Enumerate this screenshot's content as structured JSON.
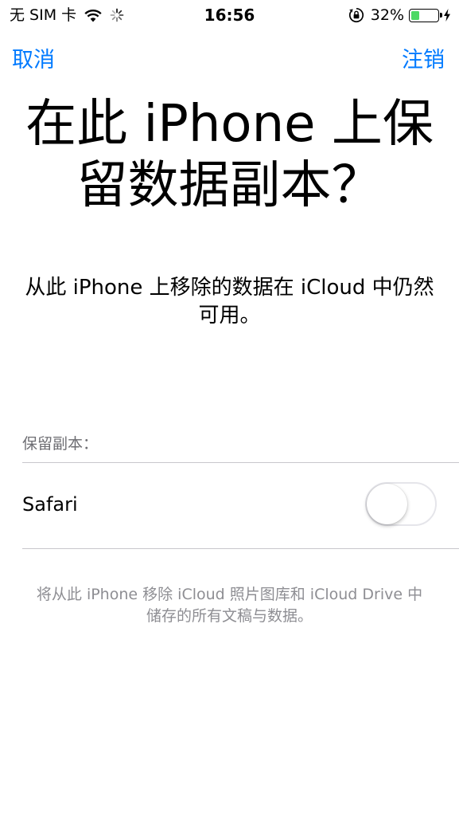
{
  "status_bar": {
    "carrier": "无 SIM 卡",
    "time": "16:56",
    "battery_percent": "32%",
    "battery_level": 0.32,
    "battery_fill_color": "#4cd964",
    "icons": [
      "wifi-icon",
      "activity-spinner-icon",
      "rotation-lock-icon",
      "battery-icon",
      "charging-bolt-icon"
    ]
  },
  "nav": {
    "cancel_label": "取消",
    "logout_label": "注销",
    "accent_color": "#007aff"
  },
  "title": "在此 iPhone 上保留数据副本？",
  "description": "从此 iPhone 上移除的数据在 iCloud 中仍然可用。",
  "section": {
    "header": "保留副本：",
    "items": [
      {
        "label": "Safari",
        "toggle_on": false
      }
    ]
  },
  "footer": "将从此 iPhone 移除 iCloud 照片图库和 iCloud Drive 中储存的所有文稿与数据。"
}
